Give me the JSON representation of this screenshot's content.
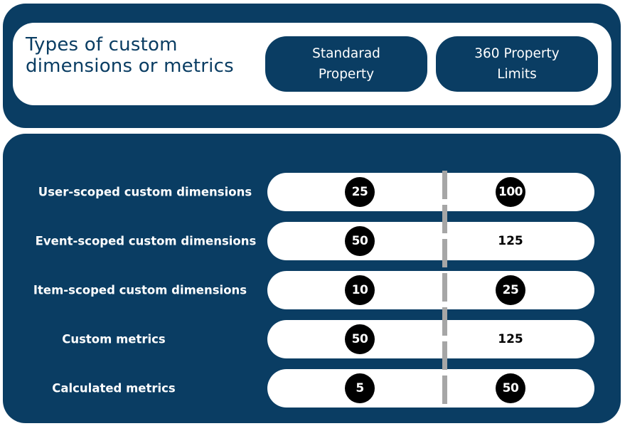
{
  "header": {
    "title": "Types of custom\ndimensions or metrics",
    "columns": [
      {
        "label": "Standarad\nProperty"
      },
      {
        "label": "360 Property\nLimits"
      }
    ]
  },
  "rows": [
    {
      "label": "User-scoped custom dimensions",
      "standard": "25",
      "standard_circled": true,
      "p360": "100",
      "p360_circled": true
    },
    {
      "label": "Event-scoped custom dimensions",
      "standard": "50",
      "standard_circled": true,
      "p360": "125",
      "p360_circled": false
    },
    {
      "label": "Item-scoped custom dimensions",
      "standard": "10",
      "standard_circled": true,
      "p360": "25",
      "p360_circled": true
    },
    {
      "label": "Custom metrics",
      "standard": "50",
      "standard_circled": true,
      "p360": "125",
      "p360_circled": false
    },
    {
      "label": "Calculated metrics",
      "standard": "5",
      "standard_circled": true,
      "p360": "50",
      "p360_circled": true
    }
  ],
  "colors": {
    "primary": "#0a3d63",
    "divider": "#a6a6a6",
    "badge": "#000000"
  }
}
